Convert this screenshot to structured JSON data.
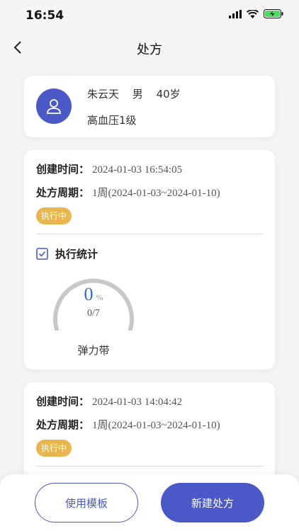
{
  "status_bar": {
    "time": "16:54"
  },
  "nav": {
    "title": "处方"
  },
  "patient": {
    "name": "朱云天",
    "gender": "男",
    "age": "40岁",
    "diagnosis": "高血压1级"
  },
  "prescriptions": [
    {
      "created_label": "创建时间：",
      "created_value": "2024-01-03 16:54:05",
      "period_label": "处方周期：",
      "period_value": "1周(2024-01-03~2024-01-10)",
      "status": "执行中",
      "stats_title": "执行统计",
      "percent": "0",
      "percent_unit": "%",
      "progress": "0/7",
      "progress_fraction": 0,
      "item_name": "弹力带"
    },
    {
      "created_label": "创建时间：",
      "created_value": "2024-01-03 14:04:42",
      "period_label": "处方周期：",
      "period_value": "1周(2024-01-03~2024-01-10)",
      "status": "执行中"
    }
  ],
  "footer": {
    "template_button": "使用模板",
    "new_button": "新建处方"
  },
  "colors": {
    "primary": "#4b59c6",
    "badge": "#e8b54f",
    "percent": "#3a6ad4"
  }
}
